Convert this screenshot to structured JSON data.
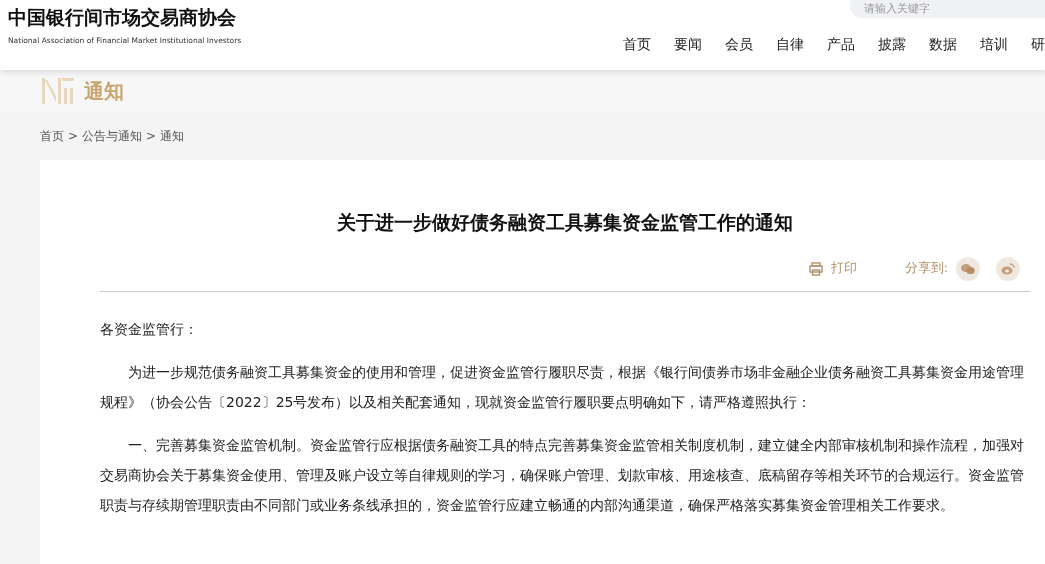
{
  "header": {
    "title": "中国银行间市场交易商协会",
    "subtitle": "National Association of Financial Market Institutional Investors",
    "search": {
      "placeholder": "请输入关键字"
    },
    "nav": [
      {
        "label": "首页"
      },
      {
        "label": "要闻"
      },
      {
        "label": "会员"
      },
      {
        "label": "自律"
      },
      {
        "label": "产品"
      },
      {
        "label": "披露"
      },
      {
        "label": "数据"
      },
      {
        "label": "培训"
      },
      {
        "label": "研"
      }
    ]
  },
  "banner": {
    "title": "通知"
  },
  "breadcrumb": [
    "首页",
    "公告与通知",
    "通知"
  ],
  "breadcrumb_separator": ">",
  "article": {
    "title": "关于进一步做好债务融资工具募集资金监管工作的通知",
    "print": "打印",
    "share_label": "分享到:",
    "paragraphs": [
      {
        "text": "各资金监管行：",
        "indent": false
      },
      {
        "text": "为进一步规范债务融资工具募集资金的使用和管理，促进资金监管行履职尽责，根据《银行间债券市场非金融企业债务融资工具募集资金用途管理规程》（协会公告〔2022〕25号发布）以及相关配套通知，现就资金监管行履职要点明确如下，请严格遵照执行：",
        "indent": true
      },
      {
        "text": "一、完善募集资金监管机制。资金监管行应根据债务融资工具的特点完善募集资金监管相关制度机制，建立健全内部审核机制和操作流程，加强对交易商协会关于募集资金使用、管理及账户设立等自律规则的学习，确保账户管理、划款审核、用途核查、底稿留存等相关环节的合规运行。资金监管职责与存续期管理职责由不同部门或业务条线承担的，资金监管行应建立畅通的内部沟通渠道，确保严格落实募集资金管理相关工作要求。",
        "indent": true
      }
    ]
  }
}
